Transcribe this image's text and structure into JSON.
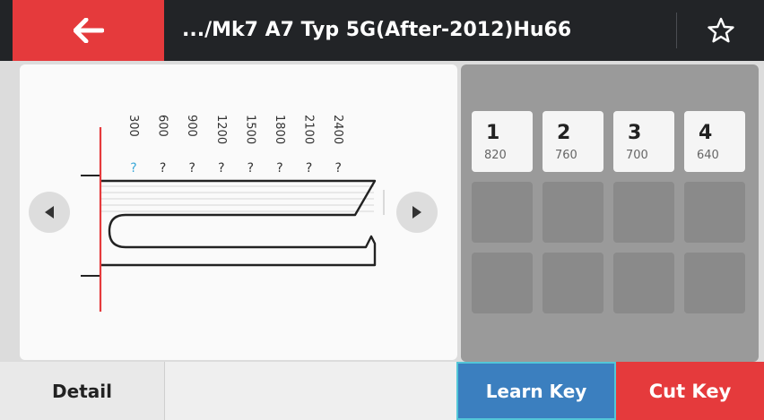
{
  "header": {
    "back_icon": "arrow-left-icon",
    "title": ".../Mk7 A7 Typ 5G(After-2012)Hu66",
    "star_icon": "star-outline-icon"
  },
  "diagram": {
    "depths": [
      "300",
      "600",
      "900",
      "1200",
      "1500",
      "1800",
      "2100",
      "2400"
    ],
    "cut_marks": [
      "?",
      "?",
      "?",
      "?",
      "?",
      "?",
      "?",
      "?"
    ],
    "prev_icon": "triangle-left-icon",
    "next_icon": "triangle-right-icon",
    "active_color": "#3aa8d8",
    "line_color": "#e53a3c"
  },
  "cuts": [
    {
      "number": "1",
      "value": "820"
    },
    {
      "number": "2",
      "value": "760"
    },
    {
      "number": "3",
      "value": "700"
    },
    {
      "number": "4",
      "value": "640"
    }
  ],
  "bottom": {
    "detail_label": "Detail",
    "learn_label": "Learn Key",
    "cut_label": "Cut Key"
  },
  "colors": {
    "accent_red": "#e53a3c",
    "learn_blue": "#3b7fbf",
    "header_dark": "#222427"
  }
}
